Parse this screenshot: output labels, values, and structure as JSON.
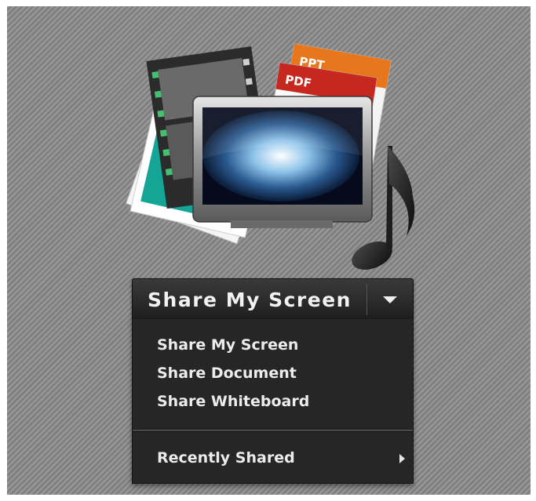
{
  "hero": {
    "icon_name": "content-share-icon",
    "ppt_label": "PPT",
    "pdf_label": "PDF"
  },
  "share_button": {
    "label": "Share My Screen",
    "dropdown_icon": "triangle-down"
  },
  "menu": {
    "items": [
      {
        "label": "Share My Screen"
      },
      {
        "label": "Share Document"
      },
      {
        "label": "Share Whiteboard"
      }
    ],
    "recent": {
      "label": "Recently Shared",
      "arrow_icon": "triangle-right"
    }
  },
  "colors": {
    "background": "#8e8e8e",
    "menu_bg": "#262626",
    "ppt_orange": "#e8761c",
    "pdf_red": "#c6281f",
    "photo_teal": "#14a596",
    "text": "#ececec"
  }
}
